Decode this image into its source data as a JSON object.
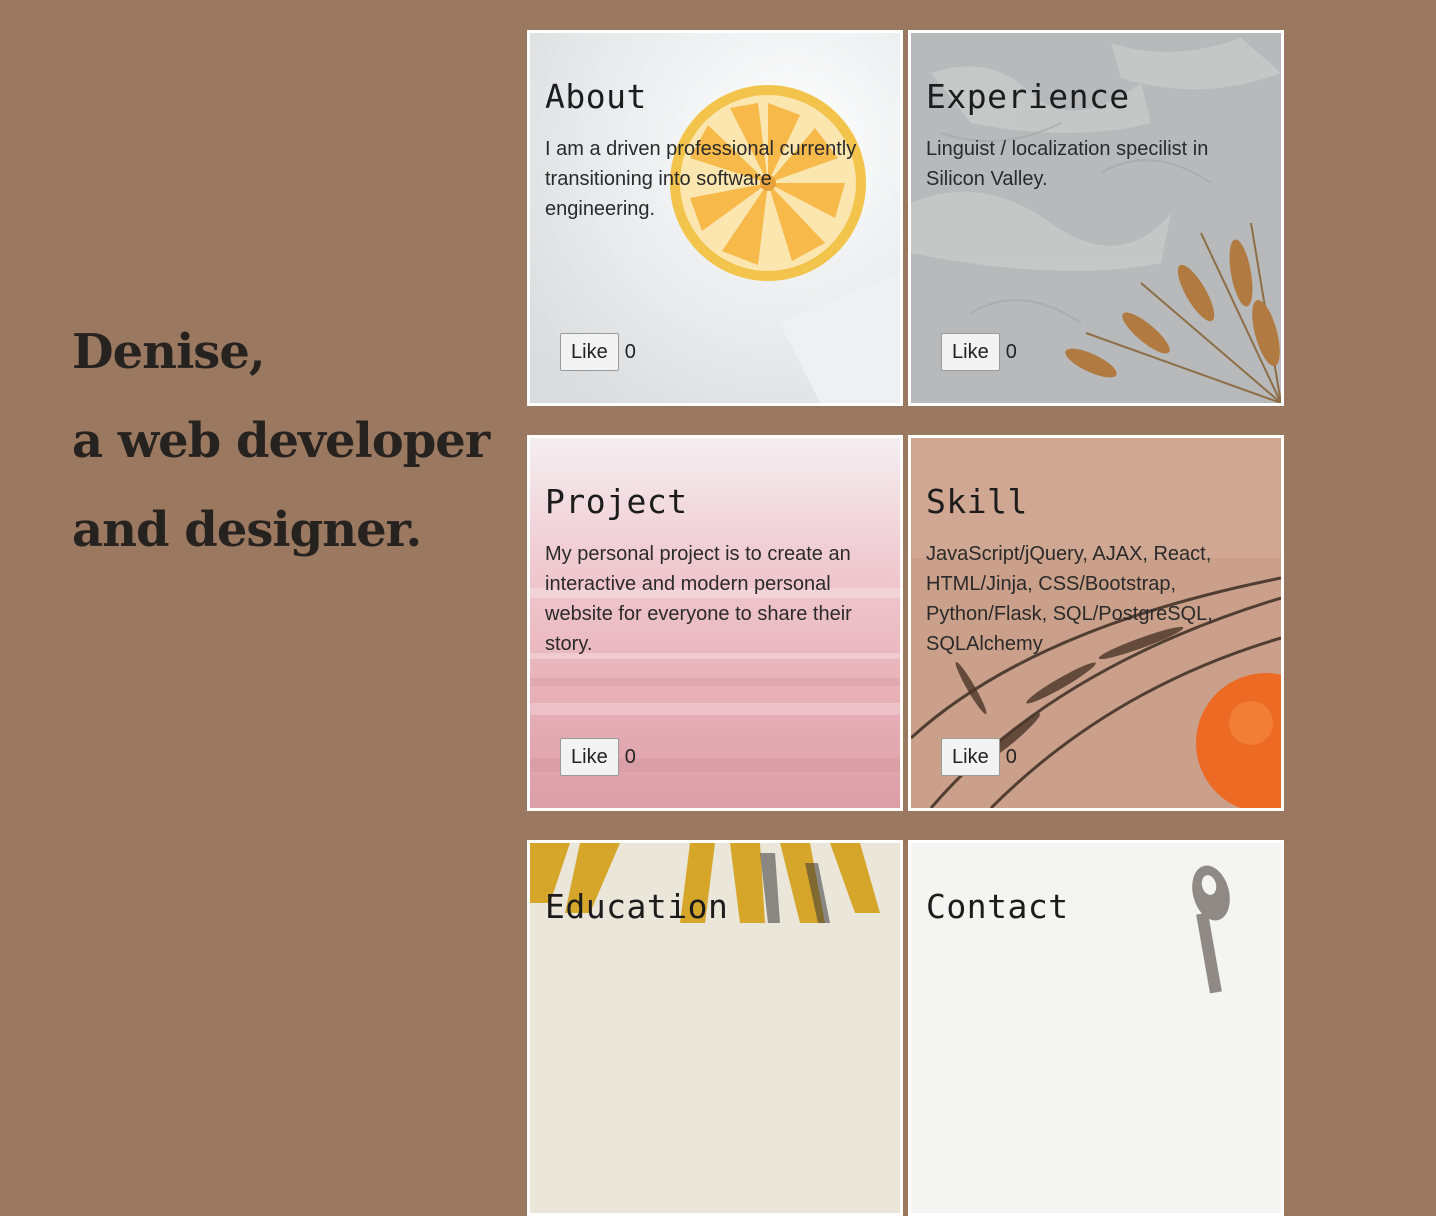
{
  "theme": {
    "background": "#9b7860",
    "card_border": "#ffffff"
  },
  "intro": {
    "line1": "Denise,",
    "line2": "a web developer",
    "line3": "and designer."
  },
  "cards": [
    {
      "title": "About",
      "text": "I am a driven professional currently transitioning into software engineering.",
      "like_label": "Like",
      "likes": "0",
      "image": "lemon-slice-image"
    },
    {
      "title": "Experience",
      "text": "Linguist / localization specilist in Silicon Valley.",
      "like_label": "Like",
      "likes": "0",
      "image": "wheat-on-plaster-image"
    },
    {
      "title": "Project",
      "text": "My personal project is to create an interactive and modern personal website for everyone to share their story.",
      "like_label": "Like",
      "likes": "0",
      "image": "pink-blur-image"
    },
    {
      "title": "Skill",
      "text": "JavaScript/jQuery, AJAX, React, HTML/Jinja, CSS/Bootstrap, Python/Flask, SQL/PostgreSQL, SQLAlchemy",
      "like_label": "Like",
      "likes": "0",
      "image": "orange-branch-image"
    },
    {
      "title": "Education",
      "image": "palm-leaf-image"
    },
    {
      "title": "Contact",
      "image": "spoon-image"
    }
  ]
}
